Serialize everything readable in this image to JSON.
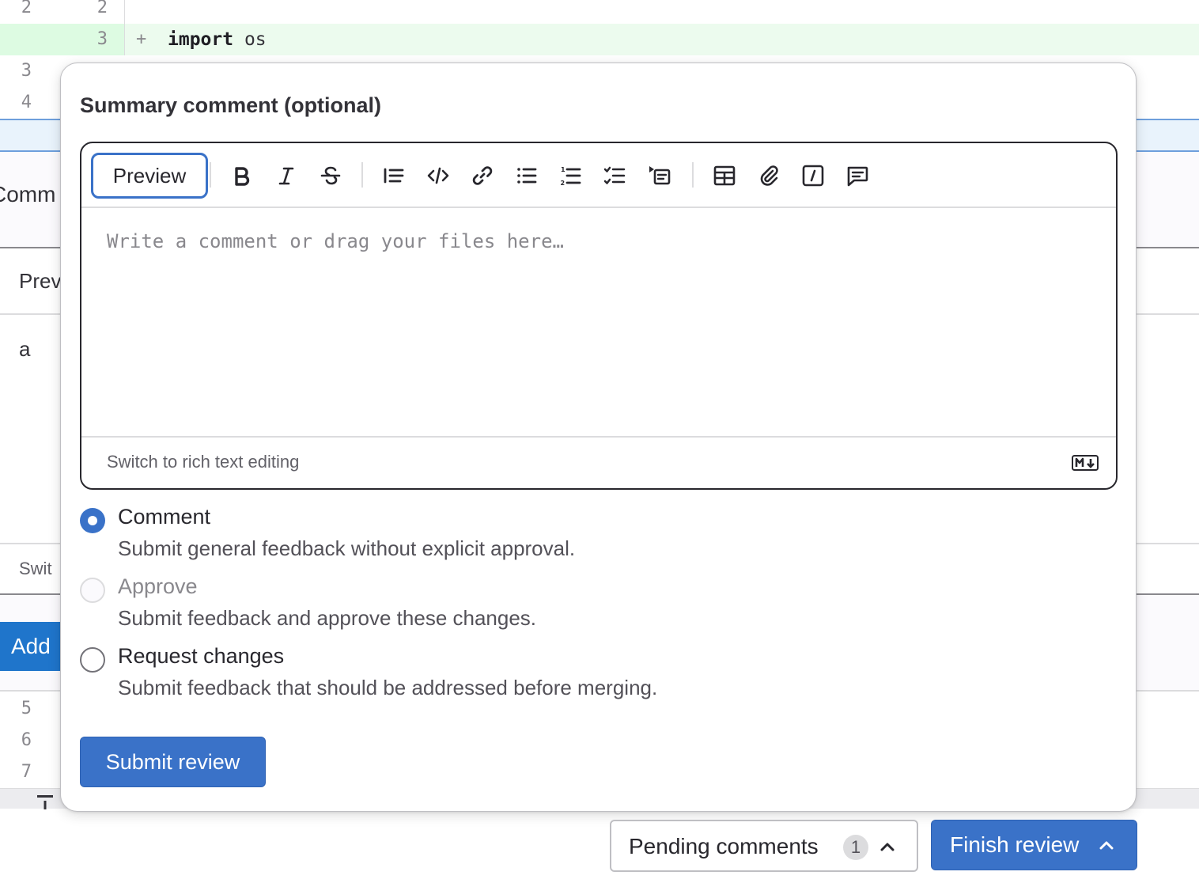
{
  "diff": {
    "lines": [
      {
        "old": "2",
        "new": "2",
        "sign": "",
        "code_keyword": "",
        "code_rest": "",
        "type": "context"
      },
      {
        "old": "",
        "new": "3",
        "sign": "+",
        "code_keyword": "import",
        "code_rest": " os",
        "type": "added"
      },
      {
        "old": "3",
        "new": "",
        "type": "context"
      },
      {
        "old": "4",
        "new": "",
        "type": "context"
      }
    ],
    "after_lines": [
      "5",
      "6",
      "7"
    ]
  },
  "background_comment_form": {
    "header_partial": "Comm",
    "tab_partial": "Prev",
    "body_text": "a",
    "switch_partial": "Swit",
    "add_button_partial": "Add"
  },
  "review_drawer": {
    "title": "Summary comment (optional)",
    "editor": {
      "preview_button": "Preview",
      "toolbar_icons": [
        "bold-icon",
        "italic-icon",
        "strikethrough-icon",
        "quote-icon",
        "code-icon",
        "link-icon",
        "bullet-list-icon",
        "numbered-list-icon",
        "task-list-icon",
        "collapsible-section-icon",
        "table-icon",
        "attach-file-icon",
        "quick-actions-icon",
        "comment-template-icon"
      ],
      "placeholder": "Write a comment or drag your files here…",
      "value": "",
      "switch_link": "Switch to rich text editing",
      "markdown_badge": "M↓"
    },
    "options": [
      {
        "label": "Comment",
        "help": "Submit general feedback without explicit approval.",
        "checked": true,
        "disabled": false
      },
      {
        "label": "Approve",
        "help": "Submit feedback and approve these changes.",
        "checked": false,
        "disabled": true
      },
      {
        "label": "Request changes",
        "help": "Submit feedback that should be addressed before merging.",
        "checked": false,
        "disabled": false
      }
    ],
    "submit_button": "Submit review"
  },
  "bottom_bar": {
    "pending_label": "Pending comments",
    "pending_count": "1",
    "finish_label": "Finish review"
  },
  "colors": {
    "primary": "#3a72c8",
    "added_line_bg": "#ecfbee",
    "hunk_bg": "#e9f3fc"
  }
}
